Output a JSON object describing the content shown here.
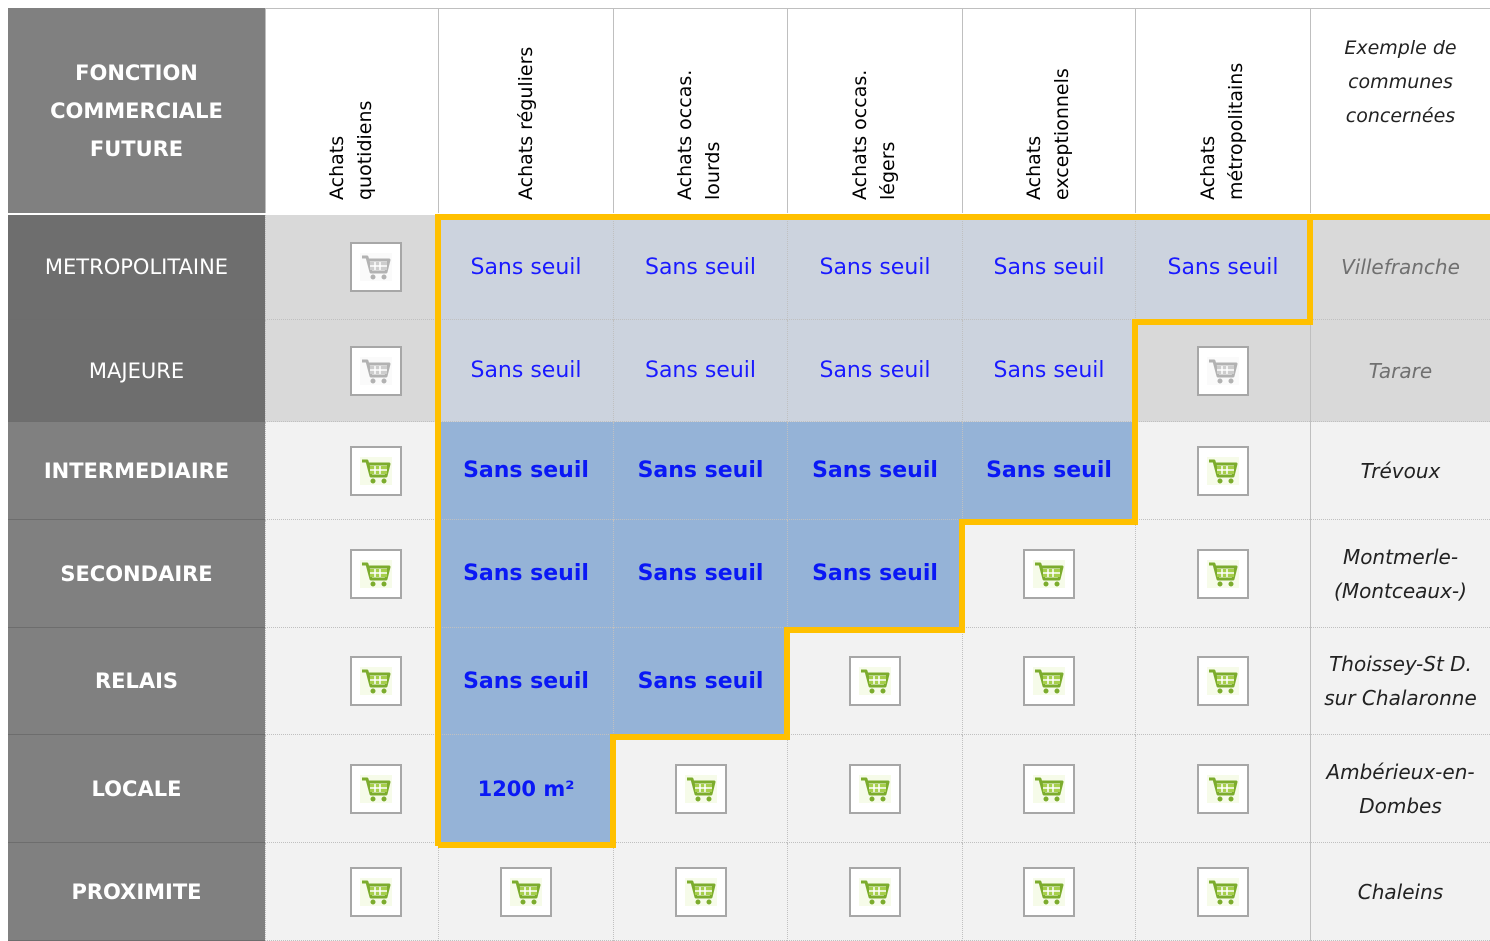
{
  "header": {
    "function_label": "FONCTION\nCOMMERCIALE\nFUTURE",
    "columns": [
      {
        "lines": [
          "Achats",
          "quotidiens"
        ]
      },
      {
        "lines": [
          "Achats réguliers"
        ]
      },
      {
        "lines": [
          "Achats occas.",
          "lourds"
        ]
      },
      {
        "lines": [
          "Achats occas.",
          "légers"
        ]
      },
      {
        "lines": [
          "Achats",
          "exceptionnels"
        ]
      },
      {
        "lines": [
          "Achats",
          "métropolitains"
        ]
      }
    ],
    "example_label": "Exemple de\ncommunes\nconcernées"
  },
  "rows": [
    {
      "label": "METROPOLITAINE",
      "cells": [
        "cart",
        "Sans seuil",
        "Sans seuil",
        "Sans seuil",
        "Sans seuil",
        "Sans seuil"
      ],
      "example": "Villefranche"
    },
    {
      "label": "MAJEURE",
      "cells": [
        "cart",
        "Sans seuil",
        "Sans seuil",
        "Sans seuil",
        "Sans seuil",
        "cart"
      ],
      "example": "Tarare"
    },
    {
      "label": "INTERMEDIAIRE",
      "cells": [
        "cart",
        "Sans seuil",
        "Sans seuil",
        "Sans seuil",
        "Sans seuil",
        "cart"
      ],
      "example": "Trévoux"
    },
    {
      "label": "SECONDAIRE",
      "cells": [
        "cart",
        "Sans seuil",
        "Sans seuil",
        "Sans seuil",
        "cart",
        "cart"
      ],
      "example": "Montmerle-\n(Montceaux-)"
    },
    {
      "label": "RELAIS",
      "cells": [
        "cart",
        "Sans seuil",
        "Sans seuil",
        "cart",
        "cart",
        "cart"
      ],
      "example": "Thoissey-St D.\nsur Chalaronne"
    },
    {
      "label": "LOCALE",
      "cells": [
        "cart",
        "1200 m²",
        "cart",
        "cart",
        "cart",
        "cart"
      ],
      "example": "Ambérieux-en-\nDombes"
    },
    {
      "label": "PROXIMITE",
      "cells": [
        "cart",
        "cart",
        "cart",
        "cart",
        "cart",
        "cart"
      ],
      "example": "Chaleins"
    }
  ],
  "colors": {
    "label_bg": "#7f7f7f",
    "metro_bg": "#ccd3de",
    "blue_bg": "#95b3d7",
    "outline": "#ffc000",
    "text_blue": "#1a1aff",
    "cart_green": "#8fbc3c"
  },
  "icons": {
    "cart": "shopping-cart-icon"
  }
}
